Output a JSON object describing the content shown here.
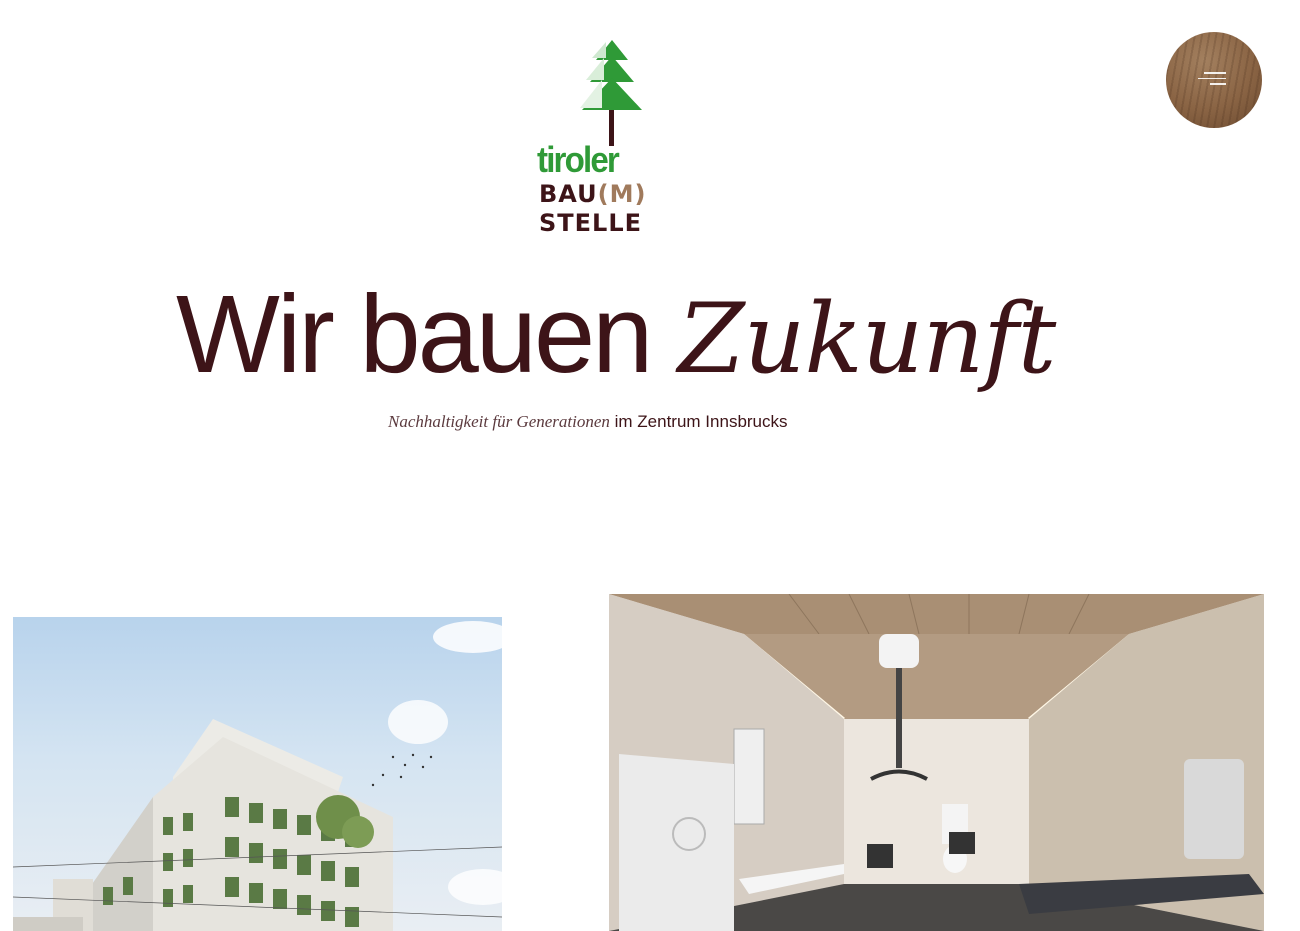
{
  "logo": {
    "word": "tiroler",
    "line1_prefix": "BAU",
    "line1_paren": "(M)",
    "line2": "STELLE",
    "icon": "fir-tree-icon"
  },
  "menu": {
    "icon": "hamburger-icon"
  },
  "hero": {
    "title_plain": "Wir bauen ",
    "title_accent": "Zukunft",
    "subtitle_italic": "Nachhaltigkeit für Generationen",
    "subtitle_plain": " im Zentrum Innsbrucks"
  },
  "images": [
    {
      "name": "building-rendering-image"
    },
    {
      "name": "accessible-washroom-image"
    }
  ],
  "colors": {
    "text": "#3d1418",
    "logo_green": "#2f9a37",
    "logo_wood": "#a07a5c",
    "background": "#ffffff"
  }
}
